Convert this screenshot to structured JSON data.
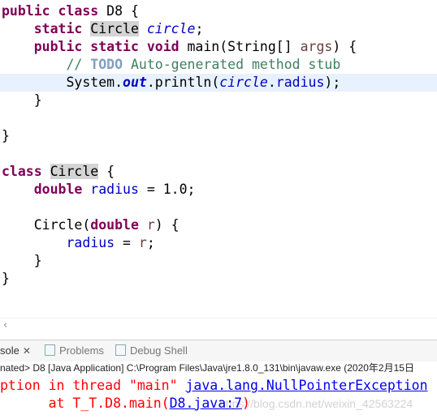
{
  "code": {
    "l1_kw": "public class",
    "l1_name": " D8 {",
    "l2_kw": "static",
    "l2_type": "Circle",
    "l2_var": "circle",
    "l2_end": ";",
    "l3_kw": "public static void",
    "l3_rest": " main(String[] ",
    "l3_param": "args",
    "l3_end": ") {",
    "l4_comment1": "// ",
    "l4_todo": "TODO",
    "l4_comment2": " Auto-generated method stub",
    "l5_a": "System.",
    "l5_out": "out",
    "l5_b": ".println(",
    "l5_circle": "circle",
    "l5_dot": ".",
    "l5_radius": "radius",
    "l5_end": ");",
    "brace": "}",
    "l9_kw": "class",
    "l9_type": "Circle",
    "l9_end": " {",
    "l10_kw": "double",
    "l10_var": "radius",
    "l10_end": " = 1.0;",
    "l12_a": "Circle(",
    "l12_kw": "double",
    "l12_param": "r",
    "l12_end": ") {",
    "l13_var": "radius",
    "l13_eq": " = ",
    "l13_param": "r",
    "l13_end": ";"
  },
  "console": {
    "tab_console": "sole",
    "tab_problems": "Problems",
    "tab_debug": "Debug Shell",
    "info": "nated> D8 [Java Application] C:\\Program Files\\Java\\jre1.8.0_131\\bin\\javaw.exe (2020年2月15日",
    "err1_text": "ption in thread \"main\" ",
    "err1_link": "java.lang.NullPointerException",
    "err2_text": "      at T_T.D8.main(",
    "err2_link": "D8.java:7",
    "err2_end": ")"
  },
  "watermark": "https://blog.csdn.net/weixin_42563224"
}
